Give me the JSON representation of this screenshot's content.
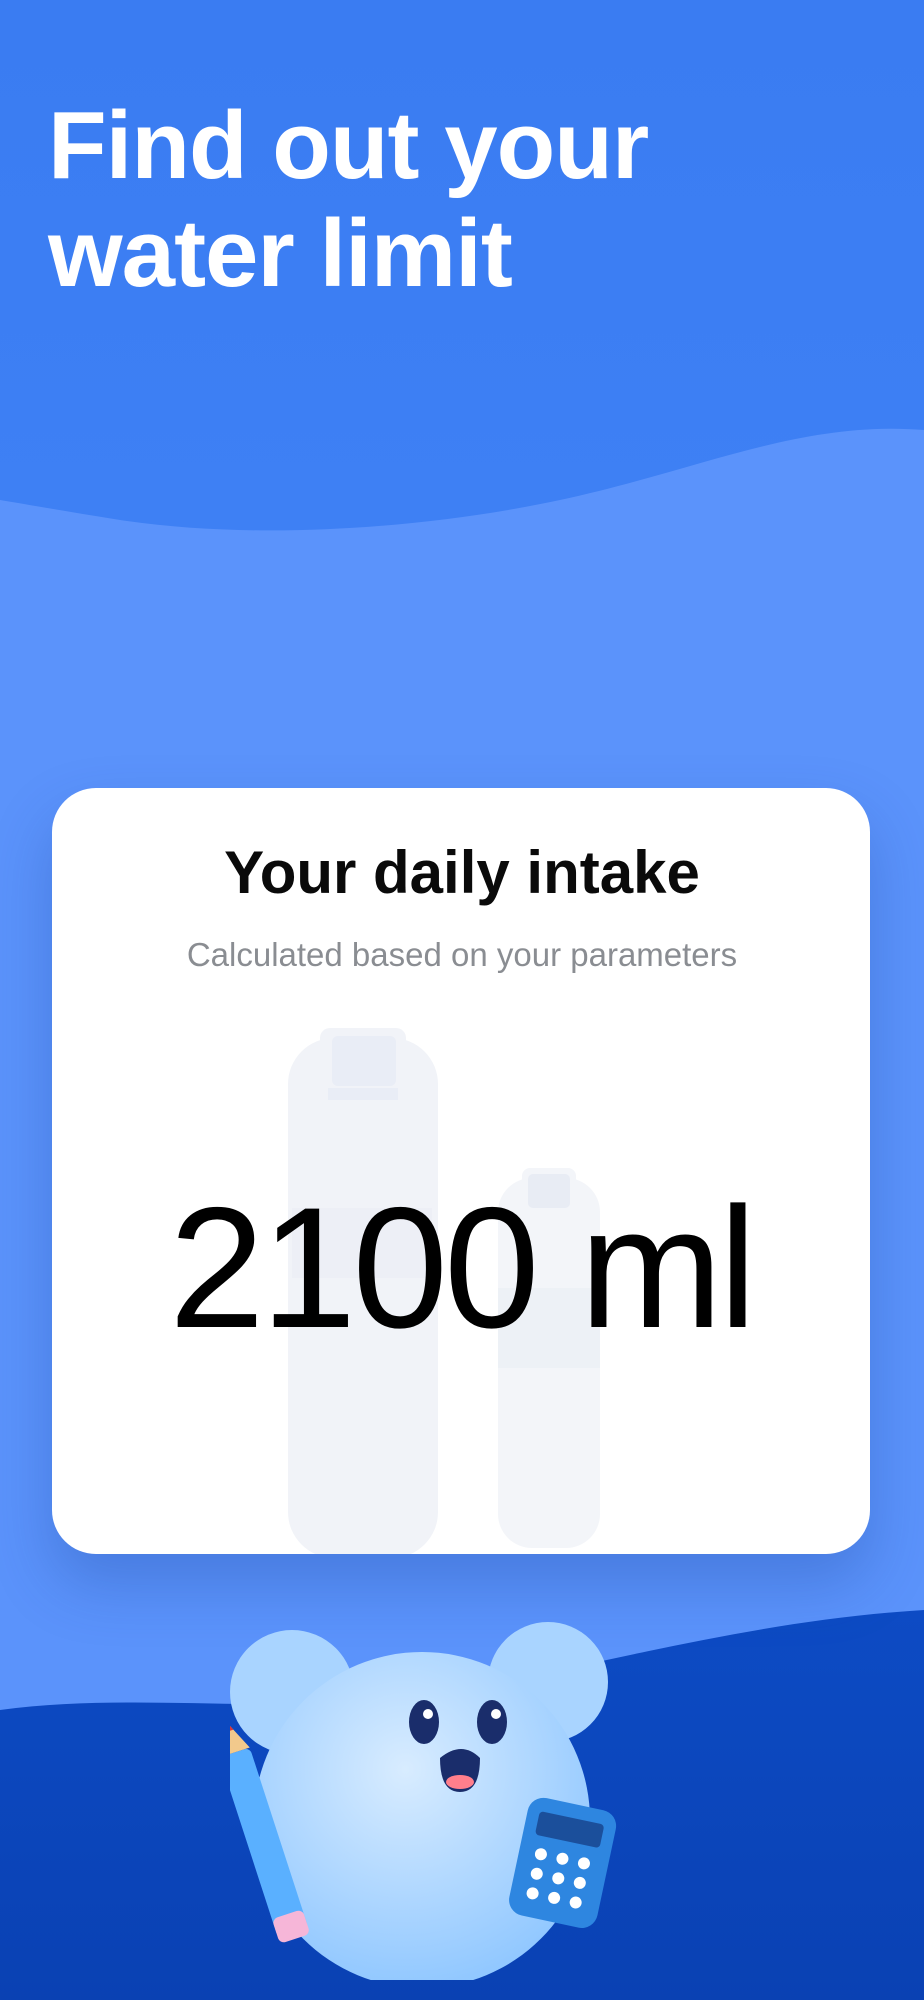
{
  "header": {
    "line1": "Find out your",
    "line2": "water limit"
  },
  "card": {
    "title": "Your daily intake",
    "subtitle": "Calculated based on your parameters",
    "value": "2100",
    "unit": "ml"
  },
  "illustration": {
    "bottles": "water-bottles-icon",
    "mascot": "mascot-with-pencil-and-calculator"
  },
  "colors": {
    "bg_top": "#3a7df2",
    "bg_mid": "#5b93fb",
    "bg_bottom": "#0b47be",
    "card": "#ffffff",
    "text_dark": "#0a0a0a",
    "text_muted": "#8a8d92"
  }
}
